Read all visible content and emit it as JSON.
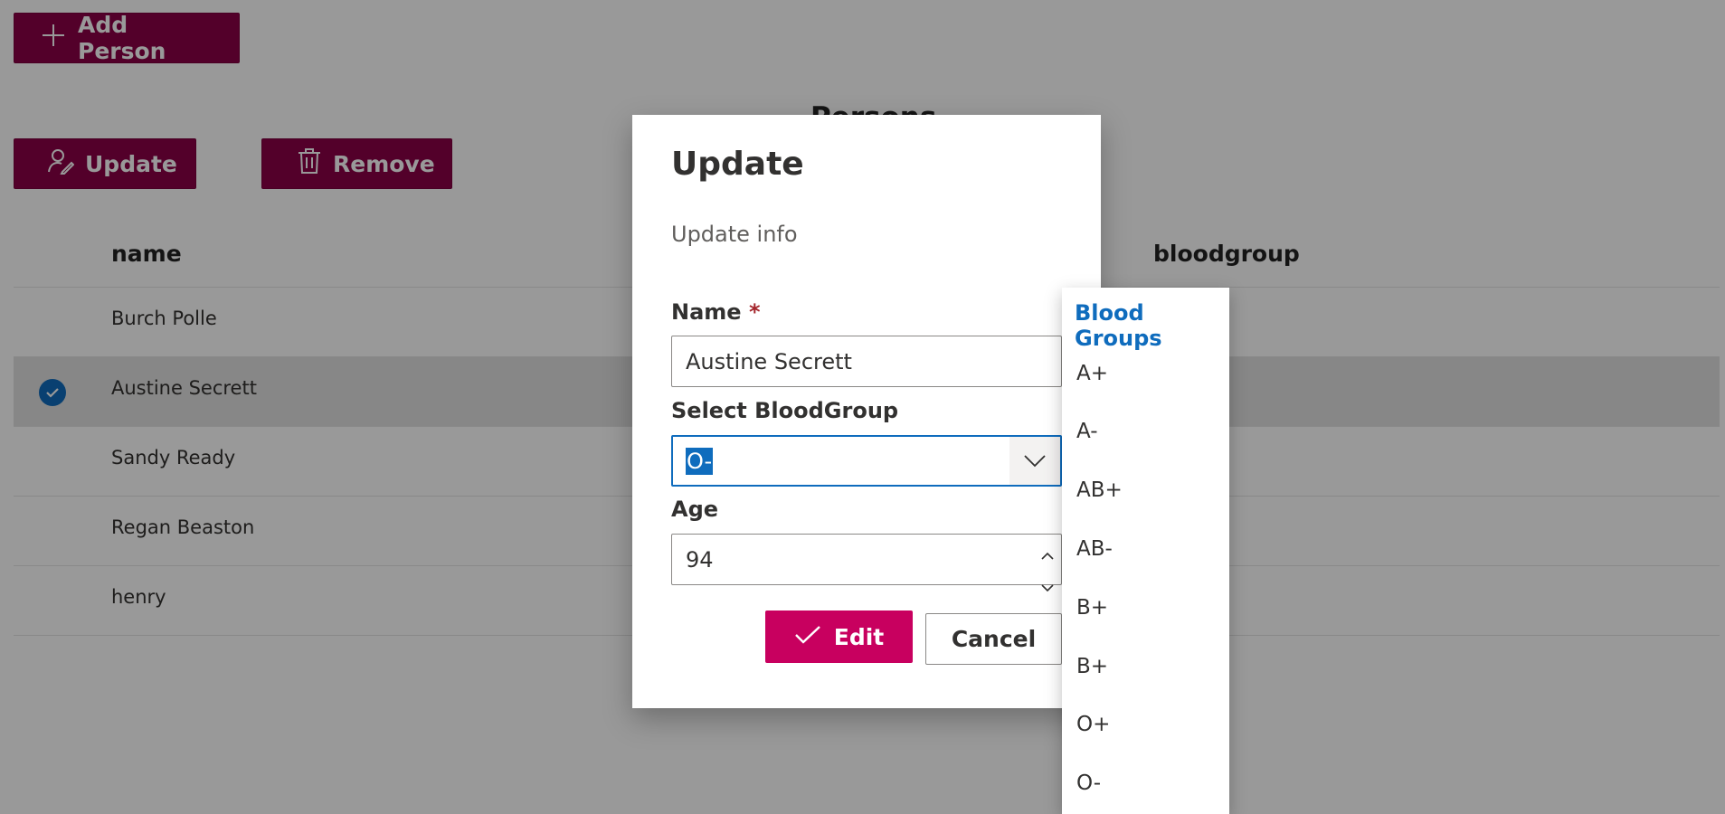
{
  "toolbar": {
    "add_person_label": "Add Person",
    "update_label": "Update",
    "remove_label": "Remove"
  },
  "list": {
    "title": "Persons",
    "columns": {
      "name": "name",
      "bloodgroup": "bloodgroup"
    },
    "rows": [
      {
        "name": "Burch Polle",
        "selected": false
      },
      {
        "name": "Austine Secrett",
        "selected": true
      },
      {
        "name": "Sandy Ready",
        "selected": false
      },
      {
        "name": "Regan Beaston",
        "selected": false
      },
      {
        "name": "henry",
        "selected": false
      }
    ]
  },
  "dialog": {
    "title": "Update",
    "subtitle": "Update info",
    "name_label": "Name",
    "required_mark": "*",
    "name_value": "Austine Secrett",
    "blood_label": "Select BloodGroup",
    "blood_value": "O-",
    "age_label": "Age",
    "age_value": "94",
    "edit_label": "Edit",
    "cancel_label": "Cancel"
  },
  "dropdown": {
    "header": "Blood Groups",
    "options": [
      "A+",
      "A-",
      "AB+",
      "AB-",
      "B+",
      "B+",
      "O+",
      "O-"
    ]
  },
  "colors": {
    "accent": "#8a0046",
    "edit_button": "#c8005f",
    "focus_blue": "#0f6cbd"
  }
}
